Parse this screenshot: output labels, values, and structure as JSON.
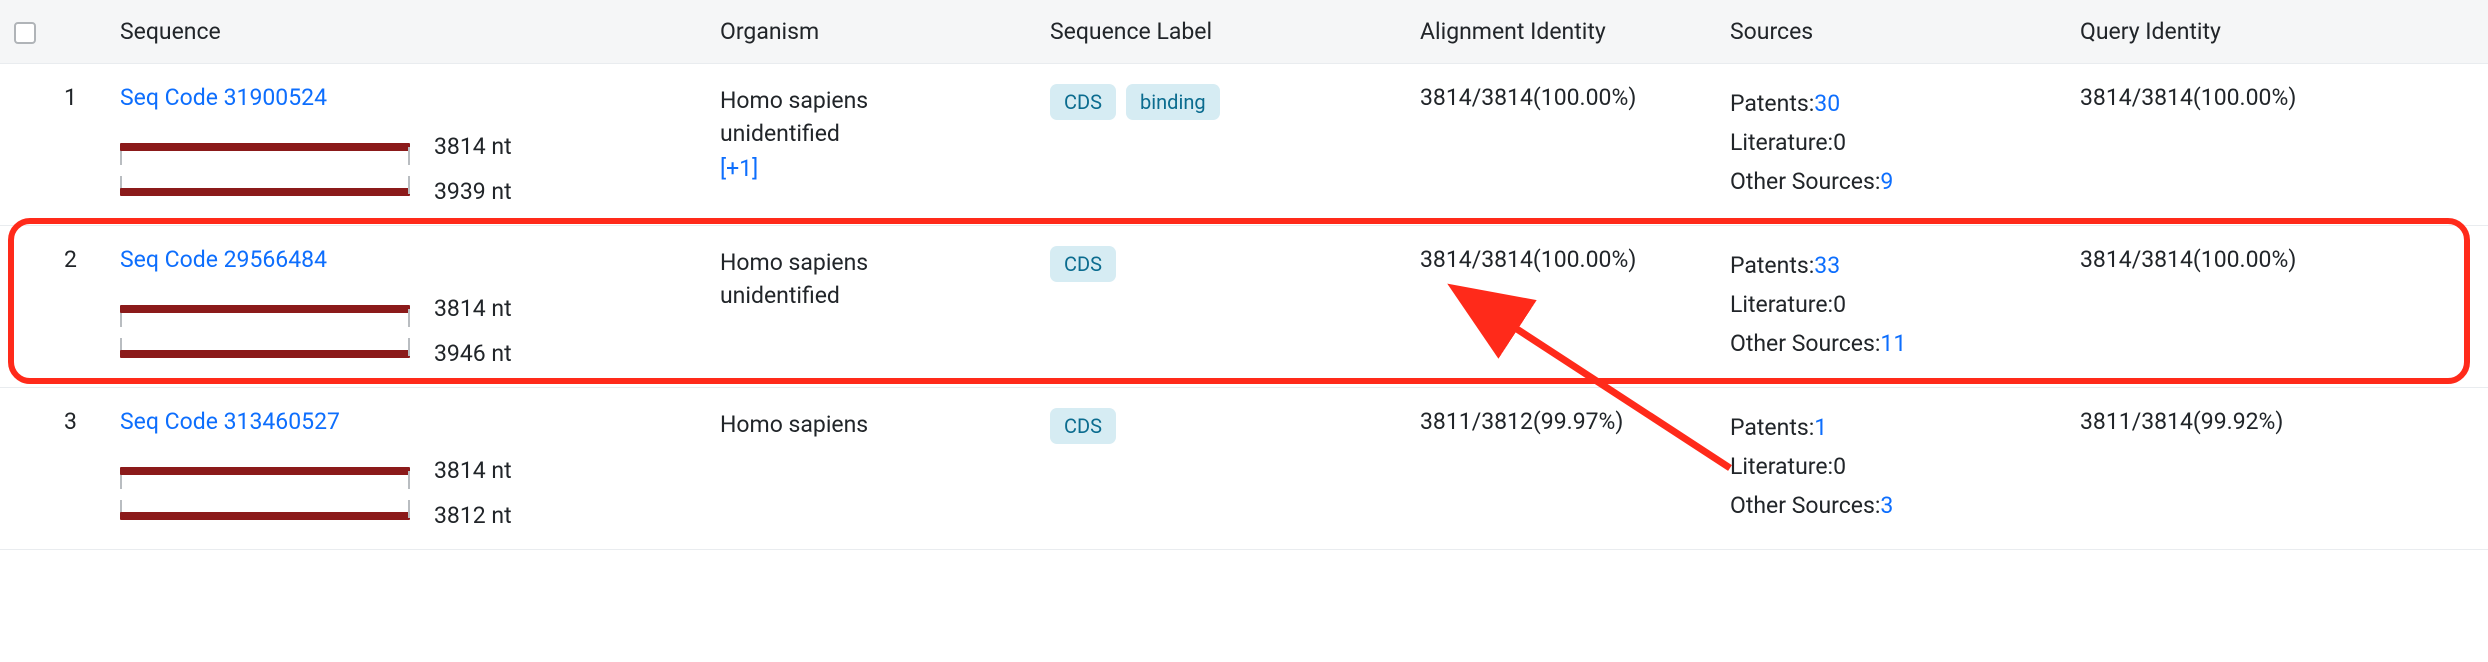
{
  "columns": {
    "sequence": "Sequence",
    "organism": "Organism",
    "label": "Sequence Label",
    "alignment": "Alignment Identity",
    "sources": "Sources",
    "query": "Query Identity"
  },
  "rows": [
    {
      "idx": "1",
      "seq_link": "Seq Code 31900524",
      "bar_top_nt": "3814 nt",
      "bar_bot_nt": "3939 nt",
      "organism_lines": [
        "Homo sapiens",
        "unidentified"
      ],
      "organism_more": "[+1]",
      "tags": [
        "CDS",
        "binding"
      ],
      "alignment": "3814/3814(100.00%)",
      "sources": {
        "patents_label": "Patents:",
        "patents_val": "30",
        "lit_label": "Literature:",
        "lit_val": "0",
        "other_label": "Other Sources:",
        "other_val": "9"
      },
      "query": "3814/3814(100.00%)"
    },
    {
      "idx": "2",
      "seq_link": "Seq Code 29566484",
      "bar_top_nt": "3814 nt",
      "bar_bot_nt": "3946 nt",
      "organism_lines": [
        "Homo sapiens",
        "unidentified"
      ],
      "organism_more": "",
      "tags": [
        "CDS"
      ],
      "alignment": "3814/3814(100.00%)",
      "sources": {
        "patents_label": "Patents:",
        "patents_val": "33",
        "lit_label": "Literature:",
        "lit_val": "0",
        "other_label": "Other Sources:",
        "other_val": "11"
      },
      "query": "3814/3814(100.00%)"
    },
    {
      "idx": "3",
      "seq_link": "Seq Code 313460527",
      "bar_top_nt": "3814 nt",
      "bar_bot_nt": "3812 nt",
      "organism_lines": [
        "Homo sapiens"
      ],
      "organism_more": "",
      "tags": [
        "CDS"
      ],
      "alignment": "3811/3812(99.97%)",
      "sources": {
        "patents_label": "Patents:",
        "patents_val": "1",
        "lit_label": "Literature:",
        "lit_val": "0",
        "other_label": "Other Sources:",
        "other_val": "3"
      },
      "query": "3811/3814(99.92%)"
    }
  ],
  "annotation": {
    "highlighted_row": 2
  }
}
